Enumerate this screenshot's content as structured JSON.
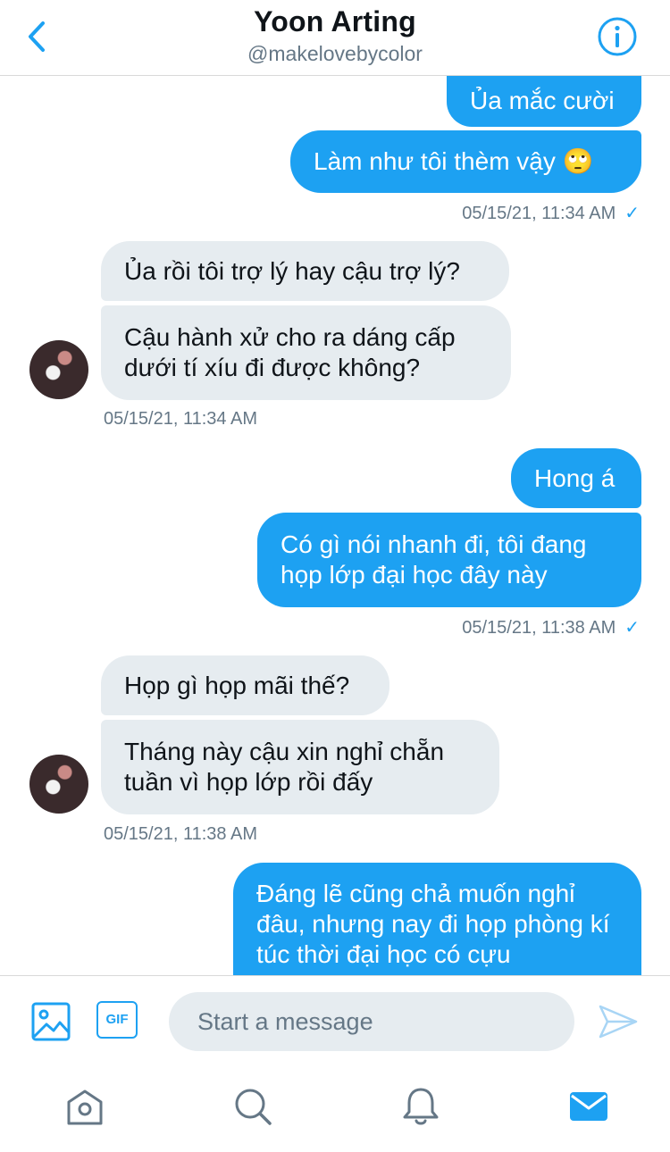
{
  "header": {
    "title": "Yoon Arting",
    "handle": "@makelovebycolor"
  },
  "messages": [
    {
      "text": "Ủa mắc cười",
      "direction": "outgoing"
    },
    {
      "text": "Làm như tôi thèm vậy 🙄",
      "direction": "outgoing"
    },
    {
      "text": "Ủa rồi tôi trợ lý hay cậu trợ lý?",
      "direction": "incoming"
    },
    {
      "text": "Cậu hành xử cho ra dáng cấp dưới tí xíu đi được không?",
      "direction": "incoming"
    },
    {
      "text": "Hong á",
      "direction": "outgoing"
    },
    {
      "text": "Có gì nói nhanh đi, tôi đang họp lớp đại học đây này",
      "direction": "outgoing"
    },
    {
      "text": "Họp gì họp mãi thế?",
      "direction": "incoming"
    },
    {
      "text": "Tháng này cậu xin nghỉ chẵn tuần vì họp lớp rồi đấy",
      "direction": "incoming"
    },
    {
      "text": "Đáng lẽ cũng chả muốn nghỉ đâu, nhưng nay đi họp phòng kí túc thời đại học có cựu",
      "direction": "outgoing"
    }
  ],
  "timestamps": [
    {
      "text": "05/15/21, 11:34 AM",
      "read_check": "✓"
    },
    {
      "text": "05/15/21, 11:34 AM"
    },
    {
      "text": "05/15/21, 11:38 AM",
      "read_check": "✓"
    },
    {
      "text": "05/15/21, 11:38 AM"
    }
  ],
  "composer": {
    "gif_label": "GIF",
    "placeholder": "Start a message"
  },
  "tabs": [
    "home",
    "search",
    "notifications",
    "messages"
  ],
  "colors": {
    "accent": "#1da1f2",
    "incoming_bubble": "#e6ecf0",
    "secondary_text": "#657786"
  }
}
